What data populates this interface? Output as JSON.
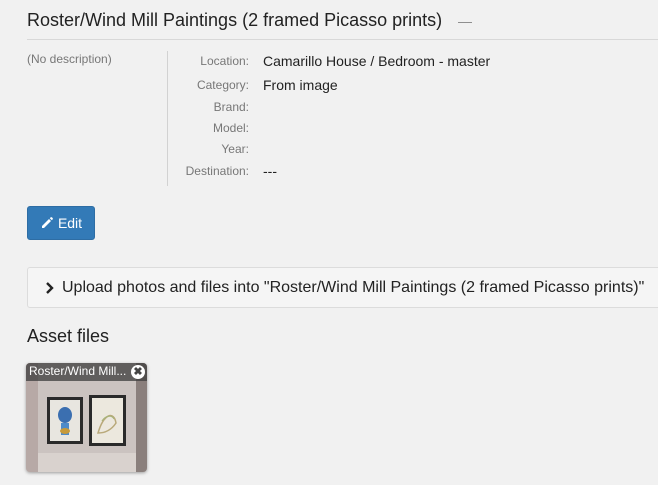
{
  "header": {
    "title": "Roster/Wind Mill Paintings (2 framed Picasso prints)",
    "dash": "—"
  },
  "description": "(No description)",
  "properties": [
    {
      "label": "Location:",
      "value": "Camarillo House / Bedroom - master"
    },
    {
      "label": "Category:",
      "value": "From image"
    },
    {
      "label": "Brand:",
      "value": ""
    },
    {
      "label": "Model:",
      "value": ""
    },
    {
      "label": "Year:",
      "value": ""
    },
    {
      "label": "Destination:",
      "value": "---"
    }
  ],
  "edit_button": {
    "label": "Edit",
    "icon": "pencil-icon",
    "color": "#337ab7"
  },
  "upload_panel": {
    "label": "Upload photos and files into \"Roster/Wind Mill Paintings (2 framed Picasso prints)\"",
    "icon": "chevron-right-icon"
  },
  "asset_files": {
    "heading": "Asset files",
    "files": [
      {
        "caption": "Roster/Wind Mill...",
        "icon": "close-icon"
      }
    ]
  }
}
